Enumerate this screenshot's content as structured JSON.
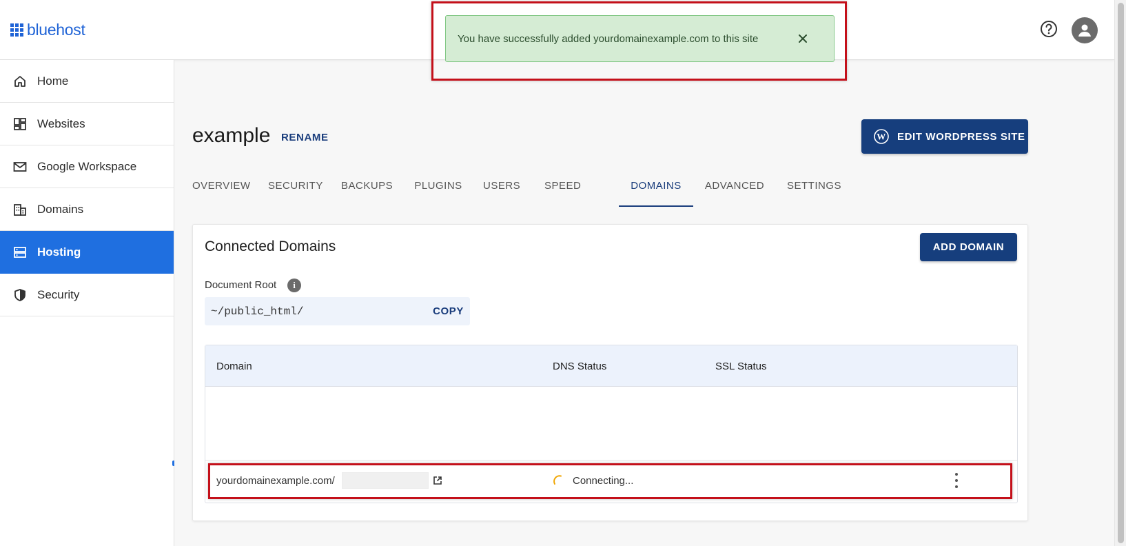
{
  "brand": {
    "name": "bluehost",
    "color": "#1f63d6"
  },
  "header": {
    "help_icon": "help-circle-icon",
    "avatar_icon": "user-avatar-icon"
  },
  "sidebar": {
    "items": [
      {
        "label": "Home",
        "icon": "home-icon"
      },
      {
        "label": "Websites",
        "icon": "websites-icon"
      },
      {
        "label": "Google Workspace",
        "icon": "mail-icon"
      },
      {
        "label": "Domains",
        "icon": "building-icon"
      },
      {
        "label": "Hosting",
        "icon": "server-icon",
        "active": true
      },
      {
        "label": "Security",
        "icon": "shield-icon"
      }
    ],
    "active_color": "#1f6fe0"
  },
  "toast": {
    "message": "You have successfully added yourdomainexample.com to this site",
    "background": "#d5ecd4"
  },
  "site": {
    "title": "example",
    "rename_label": "RENAME",
    "edit_label": "EDIT WORDPRESS SITE"
  },
  "tabs": [
    {
      "label": "OVERVIEW"
    },
    {
      "label": "SECURITY"
    },
    {
      "label": "BACKUPS"
    },
    {
      "label": "PLUGINS"
    },
    {
      "label": "USERS"
    },
    {
      "label": "SPEED"
    },
    {
      "label": "DOMAINS",
      "active": true
    },
    {
      "label": "ADVANCED"
    },
    {
      "label": "SETTINGS"
    }
  ],
  "domains_card": {
    "title": "Connected Domains",
    "add_label": "ADD DOMAIN",
    "doc_root_label": "Document Root",
    "doc_root_value": "~/public_html/",
    "copy_label": "COPY",
    "columns": [
      "Domain",
      "DNS Status",
      "SSL Status"
    ],
    "rows": [
      {
        "domain": "yourdomainexample.com/",
        "dns_status": "Connecting...",
        "ssl_status": ""
      }
    ]
  },
  "colors": {
    "primary_dark": "#163e7d",
    "highlight": "#c4101a"
  }
}
